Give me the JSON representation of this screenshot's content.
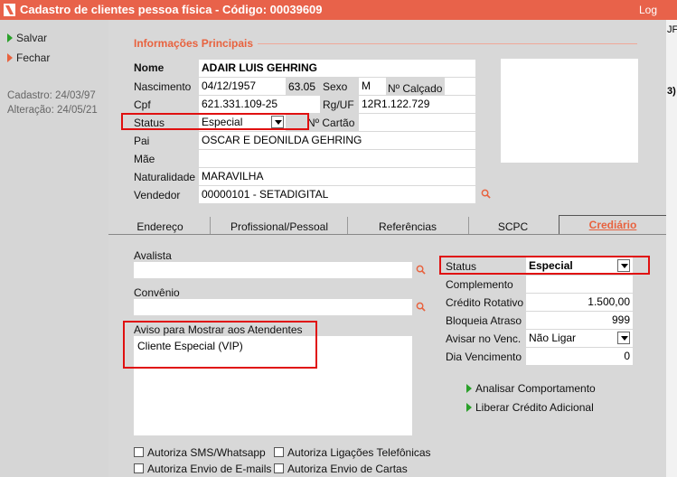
{
  "window": {
    "title": "Cadastro de clientes pessoa física - Código: 00039609",
    "log_label": "Log"
  },
  "toolbar": {
    "save_label": "Salvar",
    "save_hotkey": "S",
    "close_label": "Fechar"
  },
  "meta": {
    "cadastro": "Cadastro: 24/03/97",
    "alteracao": "Alteração: 24/05/21"
  },
  "info": {
    "section_title": "Informações Principais",
    "nome_label": "Nome",
    "nome": "ADAIR LUIS GEHRING",
    "nascimento_label": "Nascimento",
    "nascimento": "04/12/1957",
    "idade": "63.05",
    "sexo_label": "Sexo",
    "sexo": "M",
    "calcado_label": "Nº Calçado",
    "cpf_label": "Cpf",
    "cpf": "621.331.109-25",
    "rg_label": "Rg/UF",
    "rg": "12R1.122.729",
    "status_label": "Status",
    "status": "Especial",
    "cartao_label": "Nº Cartão",
    "pai_label": "Pai",
    "pai": "OSCAR E DEONILDA GEHRING",
    "mae_label": "Mãe",
    "mae": "",
    "naturalidade_label": "Naturalidade",
    "naturalidade": "MARAVILHA",
    "vendedor_label": "Vendedor",
    "vendedor": "00000101 - SETADIGITAL"
  },
  "tabs": [
    "Endereço",
    "Profissional/Pessoal",
    "Referências",
    "SCPC",
    "Crediário"
  ],
  "crediario": {
    "avalista_label": "Avalista",
    "avalista": "",
    "convenio_label": "Convênio",
    "convenio": "",
    "aviso_label": "Aviso para Mostrar aos Atendentes",
    "aviso": "Cliente Especial (VIP)",
    "status_label": "Status",
    "status": "Especial",
    "complemento_label": "Complemento",
    "complemento": "",
    "credito_label": "Crédito Rotativo",
    "credito": "1.500,00",
    "bloqueia_label": "Bloqueia Atraso",
    "bloqueia": "999",
    "avisar_label": "Avisar no Venc.",
    "avisar": "Não Ligar",
    "dia_label": "Dia Vencimento",
    "dia": "0",
    "analisar_label": "Analisar Comportamento",
    "liberar_label": "Liberar Crédito Adicional",
    "checks": [
      "Autoriza SMS/Whatsapp",
      "Autoriza Ligações Telefônicas",
      "Autoriza Envio de E-mails",
      "Autoriza Envio de Cartas"
    ]
  },
  "edge": {
    "top_text": "JF",
    "mid_text": "3)"
  },
  "colors": {
    "titlebar": "#e8624a",
    "accent": "#e8623e",
    "highlight": "#e01010"
  }
}
